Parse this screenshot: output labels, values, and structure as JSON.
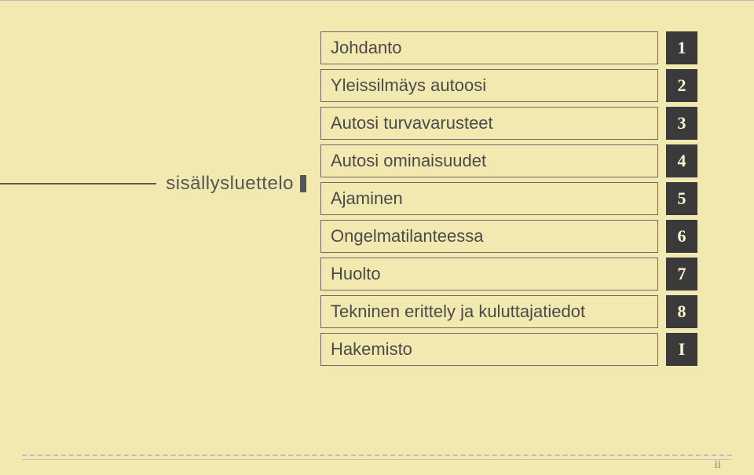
{
  "toc_label": "sisällysluettelo",
  "items": [
    {
      "label": "Johdanto",
      "num": "1"
    },
    {
      "label": "Yleissilmäys autoosi",
      "num": "2"
    },
    {
      "label": "Autosi turvavarusteet",
      "num": "3"
    },
    {
      "label": "Autosi ominaisuudet",
      "num": "4"
    },
    {
      "label": "Ajaminen",
      "num": "5"
    },
    {
      "label": "Ongelmatilanteessa",
      "num": "6"
    },
    {
      "label": "Huolto",
      "num": "7"
    },
    {
      "label": "Tekninen erittely ja kuluttajatiedot",
      "num": "8"
    },
    {
      "label": "Hakemisto",
      "num": "I"
    }
  ],
  "page_number": "ii"
}
